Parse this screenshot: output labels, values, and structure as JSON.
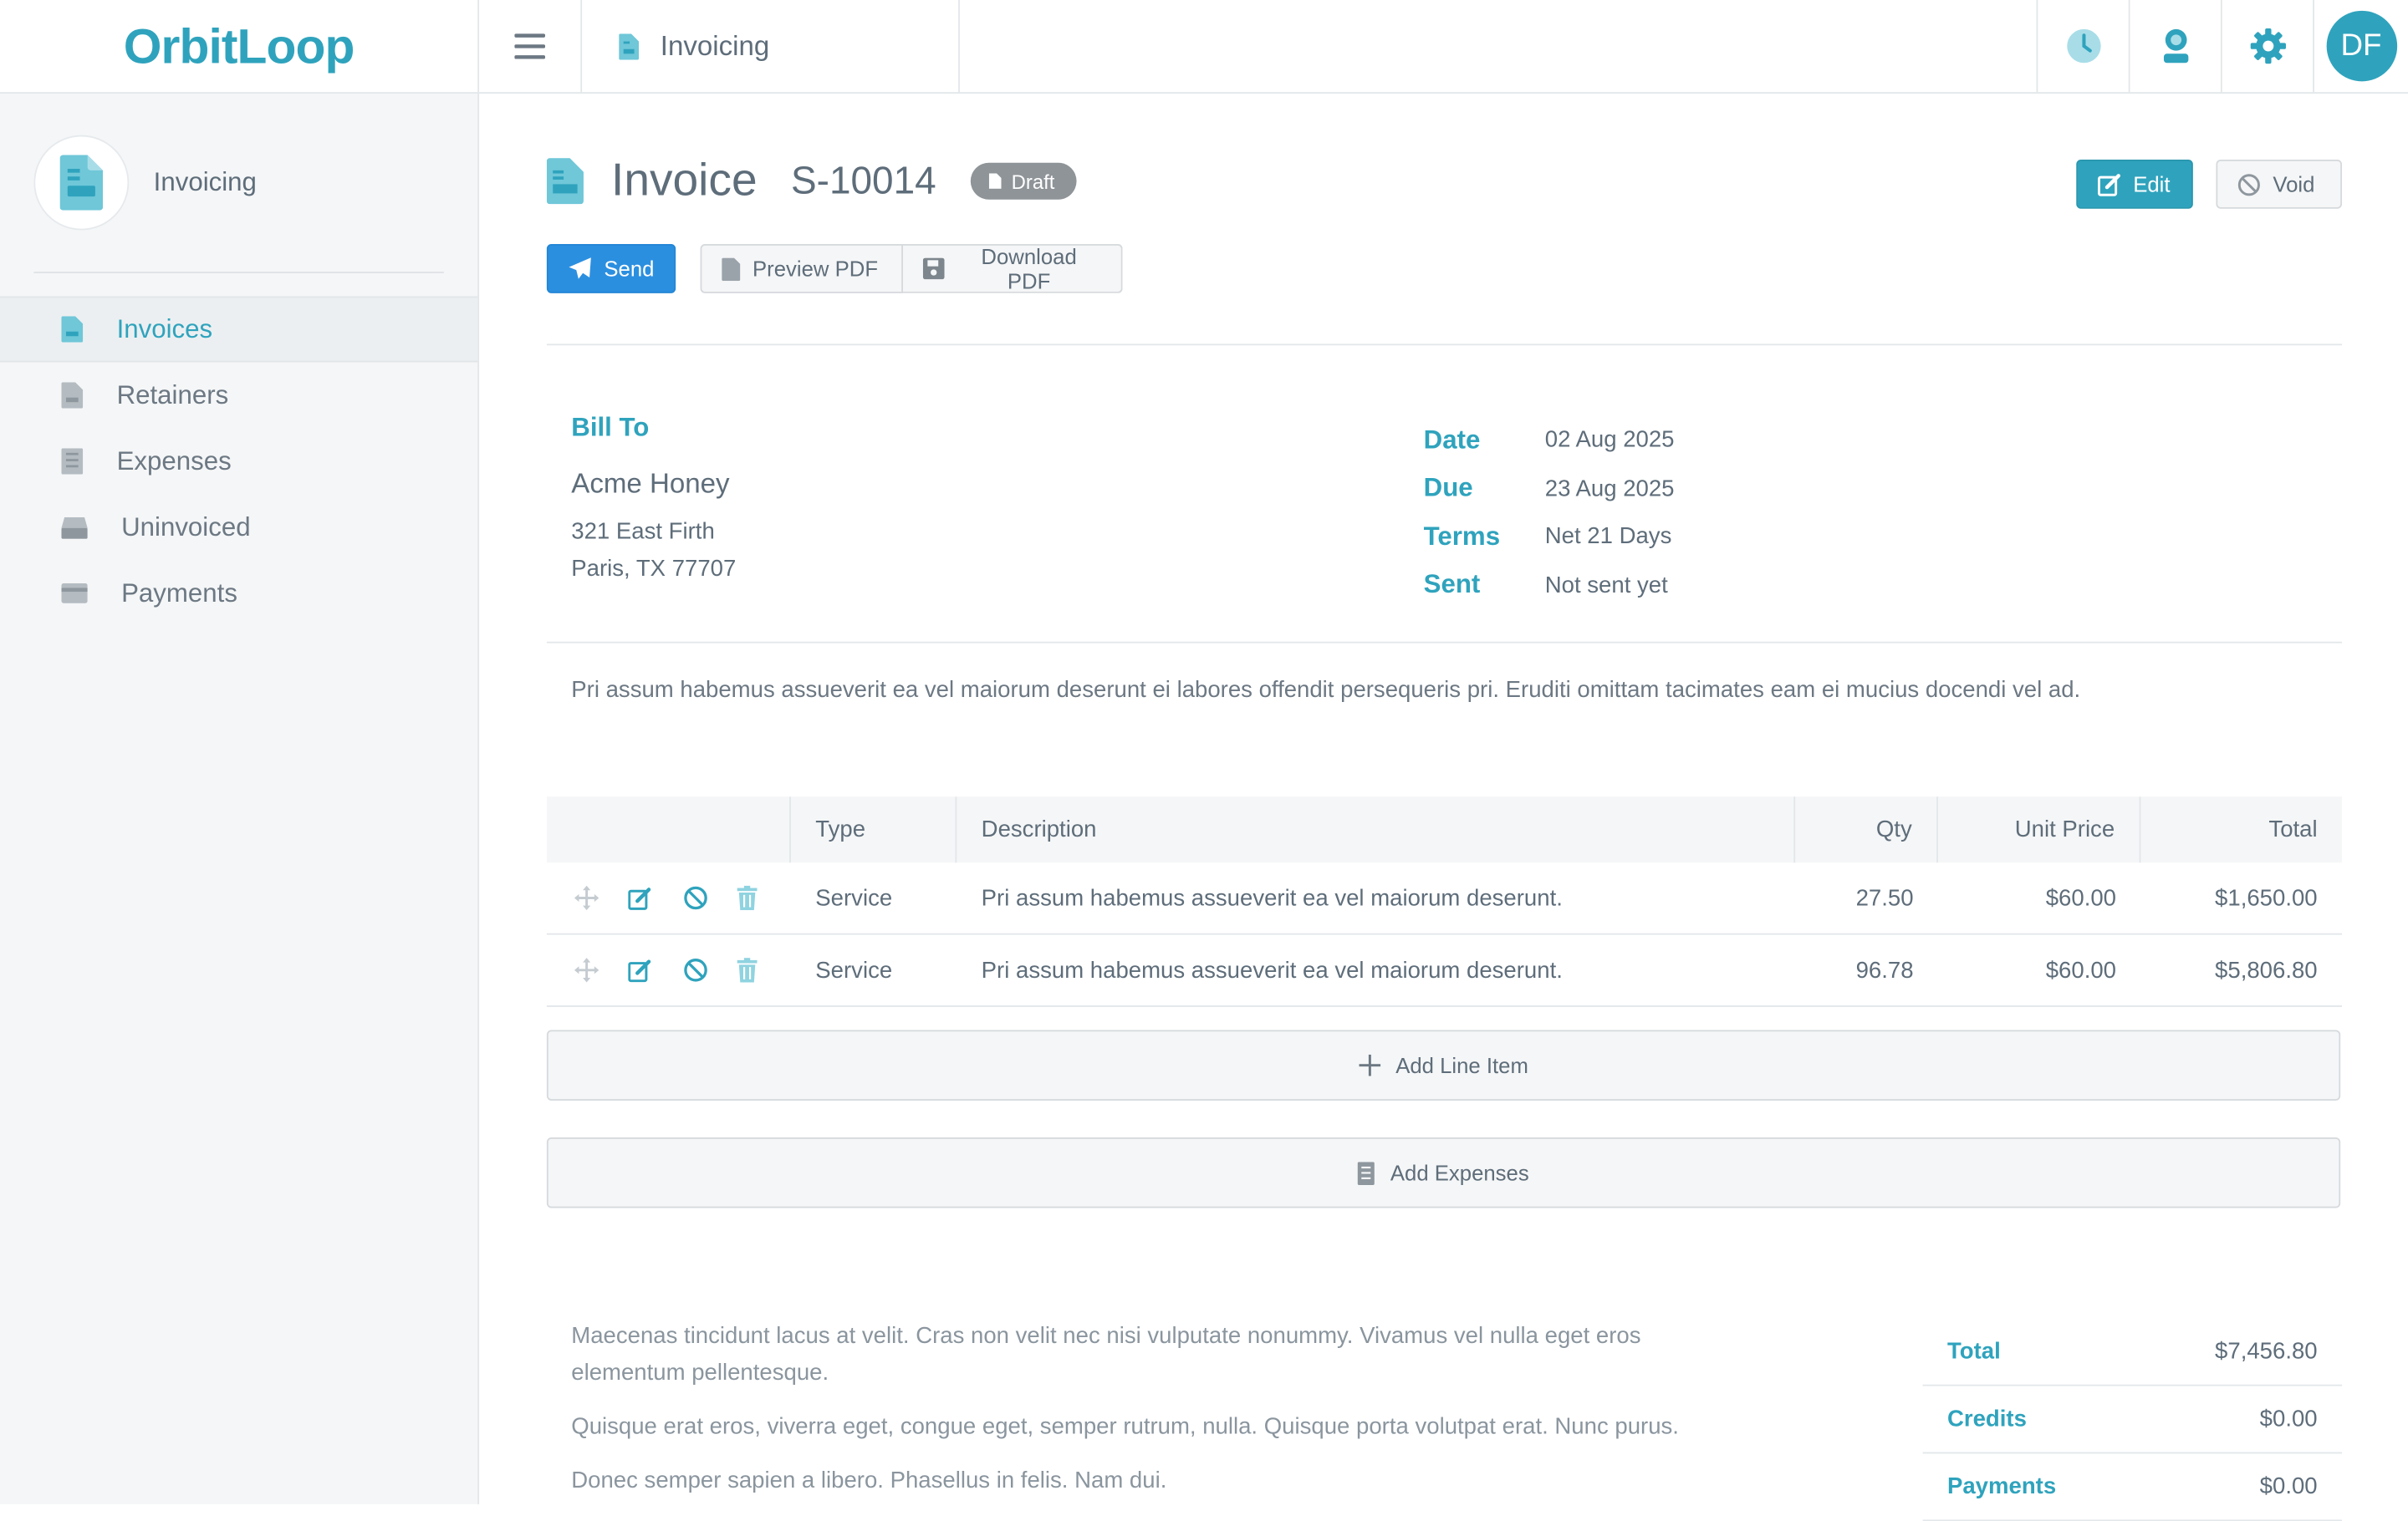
{
  "brand": {
    "logo_text": "OrbitLoop",
    "accent": "#2fa3bd"
  },
  "topbar": {
    "breadcrumb": "Invoicing",
    "icons": [
      "clock-icon",
      "user-badge-icon",
      "gear-icon"
    ],
    "avatar_initials": "DF"
  },
  "sidebar": {
    "title": "Invoicing",
    "items": [
      {
        "label": "Invoices",
        "icon": "invoice-doc-icon",
        "active": true
      },
      {
        "label": "Retainers",
        "icon": "doc-icon"
      },
      {
        "label": "Expenses",
        "icon": "receipt-icon"
      },
      {
        "label": "Uninvoiced",
        "icon": "inbox-icon"
      },
      {
        "label": "Payments",
        "icon": "credit-card-icon"
      }
    ]
  },
  "invoice": {
    "title": "Invoice",
    "number": "S-10014",
    "status": "Draft",
    "actions": {
      "edit": "Edit",
      "void": "Void",
      "send": "Send",
      "preview": "Preview PDF",
      "download": "Download PDF"
    },
    "bill_to_label": "Bill To",
    "client": {
      "name": "Acme Honey",
      "address_line1": "321 East Firth",
      "address_line2": "Paris, TX 77707"
    },
    "meta": [
      {
        "key": "Date",
        "value": "02 Aug 2025"
      },
      {
        "key": "Due",
        "value": "23 Aug 2025"
      },
      {
        "key": "Terms",
        "value": "Net 21 Days"
      },
      {
        "key": "Sent",
        "value": "Not sent yet"
      }
    ],
    "memo": "Pri assum habemus assueverit ea vel maiorum deserunt ei labores offendit persequeris pri. Eruditi omittam tacimates eam ei mucius docendi vel ad.",
    "table": {
      "headers": {
        "type": "Type",
        "description": "Description",
        "qty": "Qty",
        "unit_price": "Unit Price",
        "total": "Total"
      },
      "rows": [
        {
          "type": "Service",
          "description": "Pri assum habemus assueverit ea vel maiorum deserunt.",
          "qty": "27.50",
          "unit_price": "$60.00",
          "total": "$1,650.00"
        },
        {
          "type": "Service",
          "description": "Pri assum habemus assueverit ea vel maiorum deserunt.",
          "qty": "96.78",
          "unit_price": "$60.00",
          "total": "$5,806.80"
        }
      ]
    },
    "add_line_item": "Add Line Item",
    "add_expenses": "Add Expenses",
    "notes": [
      "Maecenas tincidunt lacus at velit. Cras non velit nec nisi vulputate nonummy. Vivamus vel nulla eget eros elementum pellentesque.",
      "Quisque erat eros, viverra eget, congue eget, semper rutrum, nulla. Quisque porta volutpat erat. Nunc purus.",
      "Donec semper sapien a libero. Phasellus in felis. Nam dui."
    ],
    "totals": [
      {
        "key": "Total",
        "value": "$7,456.80"
      },
      {
        "key": "Credits",
        "value": "$0.00"
      },
      {
        "key": "Payments",
        "value": "$0.00"
      }
    ]
  }
}
